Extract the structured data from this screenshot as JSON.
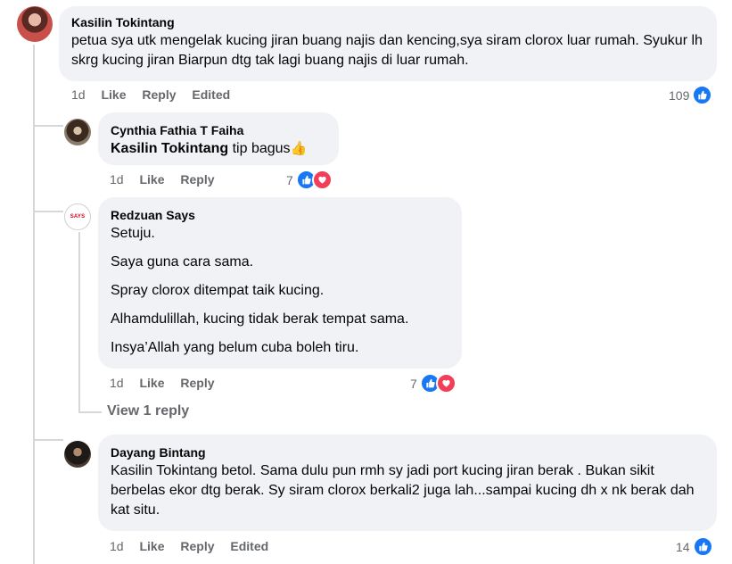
{
  "colors": {
    "bubble_bg": "#f0f2f5",
    "meta_text": "#65676b",
    "like_blue": "#1877f2",
    "love_red": "#f33e58",
    "thread_line": "#d5d7da"
  },
  "comments": [
    {
      "author": "Kasilin Tokintang",
      "text": "petua sya utk mengelak kucing jiran buang najis dan kencing,sya siram clorox luar rumah. Syukur lh skrg kucing jiran Biarpun dtg tak lagi buang najis di luar rumah.",
      "time": "1d",
      "like_label": "Like",
      "reply_label": "Reply",
      "edited_label": "Edited",
      "reaction_count": "109",
      "reaction_icons": [
        "like-icon"
      ]
    },
    {
      "author": "Cynthia Fathia T Faiha",
      "mention": "Kasilin Tokintang",
      "text": " tip bagus",
      "emoji": "👍",
      "time": "1d",
      "like_label": "Like",
      "reply_label": "Reply",
      "reaction_count": "7",
      "reaction_icons": [
        "like-icon",
        "love-icon"
      ]
    },
    {
      "author": "Redzuan Says",
      "avatar_text": "SAYS",
      "paragraphs": [
        "Setuju.",
        "Saya guna cara sama.",
        "Spray clorox ditempat taik kucing.",
        "Alhamdulillah, kucing tidak berak tempat sama.",
        "Insya’Allah yang belum cuba boleh tiru."
      ],
      "time": "1d",
      "like_label": "Like",
      "reply_label": "Reply",
      "reaction_count": "7",
      "reaction_icons": [
        "like-icon",
        "love-icon"
      ],
      "view_replies_label": "View 1 reply"
    },
    {
      "author": "Dayang Bintang",
      "mention": "Kasilin Tokintang",
      "text": " betol. Sama dulu pun rmh sy jadi port kucing jiran berak . Bukan sikit berbelas ekor dtg berak. Sy siram clorox berkali2 juga lah...sampai kucing dh x nk berak dah kat situ.",
      "time": "1d",
      "like_label": "Like",
      "reply_label": "Reply",
      "edited_label": "Edited",
      "reaction_count": "14",
      "reaction_icons": [
        "like-icon"
      ]
    }
  ]
}
